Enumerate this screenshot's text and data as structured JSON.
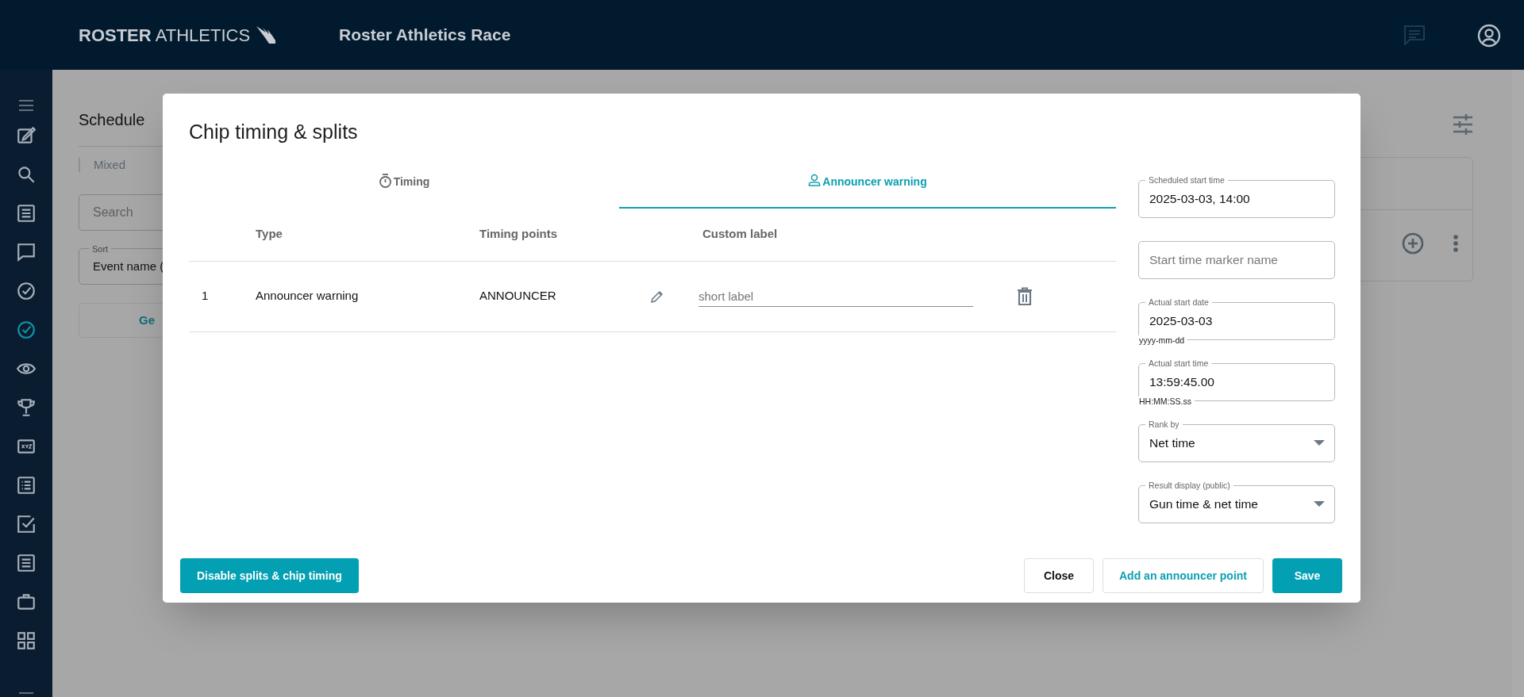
{
  "header": {
    "brand_bold": "ROSTER",
    "brand_light": "ATHLETICS",
    "title": "Roster Athletics Race"
  },
  "sidebar": {
    "items": [
      {
        "kind": "edit",
        "selected": false
      },
      {
        "kind": "search",
        "selected": false
      },
      {
        "kind": "article",
        "selected": false
      },
      {
        "kind": "chat",
        "selected": false
      },
      {
        "kind": "check",
        "selected": false
      },
      {
        "kind": "check",
        "selected": true
      },
      {
        "kind": "eye",
        "selected": false
      },
      {
        "kind": "trophy",
        "selected": false
      },
      {
        "kind": "xyz",
        "selected": false
      },
      {
        "kind": "list",
        "selected": false
      },
      {
        "kind": "checkbox",
        "selected": false
      },
      {
        "kind": "article",
        "selected": false
      },
      {
        "kind": "briefcase",
        "selected": false
      },
      {
        "kind": "grid",
        "selected": false
      }
    ]
  },
  "background": {
    "heading": "Schedule",
    "filter": "Mixed",
    "search": {
      "placeholder": "Search"
    },
    "sort": {
      "label": "Sort",
      "value": "Event name ("
    },
    "button": "Ge"
  },
  "dialog": {
    "title": "Chip timing & splits",
    "tabs": [
      {
        "label": "Timing",
        "kind": "timer",
        "selected": false
      },
      {
        "label": "Announcer warning",
        "kind": "person",
        "selected": true
      }
    ],
    "table": {
      "columns": [
        "Type",
        "Timing points",
        "Custom label"
      ],
      "rows": [
        {
          "index": "1",
          "type": "Announcer warning",
          "timing_point": "ANNOUNCER",
          "custom_label": {
            "placeholder": "short label"
          }
        }
      ]
    },
    "fields": [
      {
        "kind": "text",
        "label": "Scheduled start time",
        "value": "2025-03-03, 14:00"
      },
      {
        "kind": "text",
        "placeholder": "Start time marker name"
      },
      {
        "kind": "text",
        "label": "Actual start date",
        "value": "2025-03-03",
        "hint": "yyyy-mm-dd"
      },
      {
        "kind": "text",
        "label": "Actual start time",
        "value": "13:59:45.00",
        "hint": "HH:MM:SS.ss"
      },
      {
        "kind": "select",
        "label": "Rank by",
        "value": "Net time"
      },
      {
        "kind": "select",
        "label": "Result display (public)",
        "value": "Gun time & net time"
      }
    ],
    "buttons": [
      {
        "label": "Disable splits & chip timing",
        "kind": "primary"
      },
      {
        "label": "Close",
        "kind": "outline"
      },
      {
        "label": "Add an announcer point",
        "kind": "outline-accent"
      },
      {
        "label": "Save",
        "kind": "primary"
      }
    ]
  }
}
